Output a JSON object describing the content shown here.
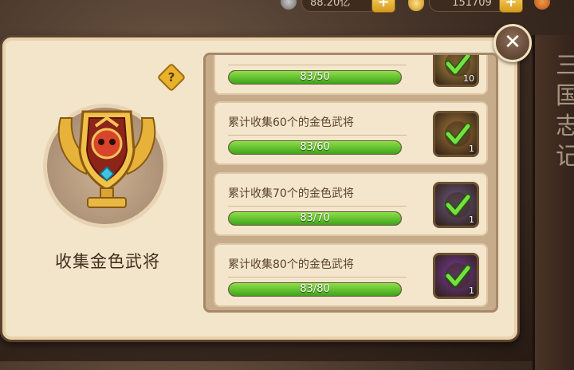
{
  "topbar": {
    "currency1": "88.20亿",
    "currency2": "151709"
  },
  "side_text": "三国志记",
  "badge": {
    "title": "收集金色武将",
    "help": "?"
  },
  "close": "✕",
  "achievements": [
    {
      "label": "",
      "progress": "83/50",
      "fraction": 1.0,
      "reward_count": "10",
      "reward_color": "#b99142"
    },
    {
      "label": "累计收集60个的金色武将",
      "progress": "83/60",
      "fraction": 1.0,
      "reward_count": "1",
      "reward_color": "#a97a3a"
    },
    {
      "label": "累计收集70个的金色武将",
      "progress": "83/70",
      "fraction": 1.0,
      "reward_count": "1",
      "reward_color": "#6e5a86"
    },
    {
      "label": "累计收集80个的金色武将",
      "progress": "83/80",
      "fraction": 1.0,
      "reward_count": "1",
      "reward_color": "#7b3c9e"
    }
  ],
  "colors": {
    "progress_green": "#5cc22a",
    "panel": "#f3e5c9",
    "frame": "#c7ac8c"
  }
}
